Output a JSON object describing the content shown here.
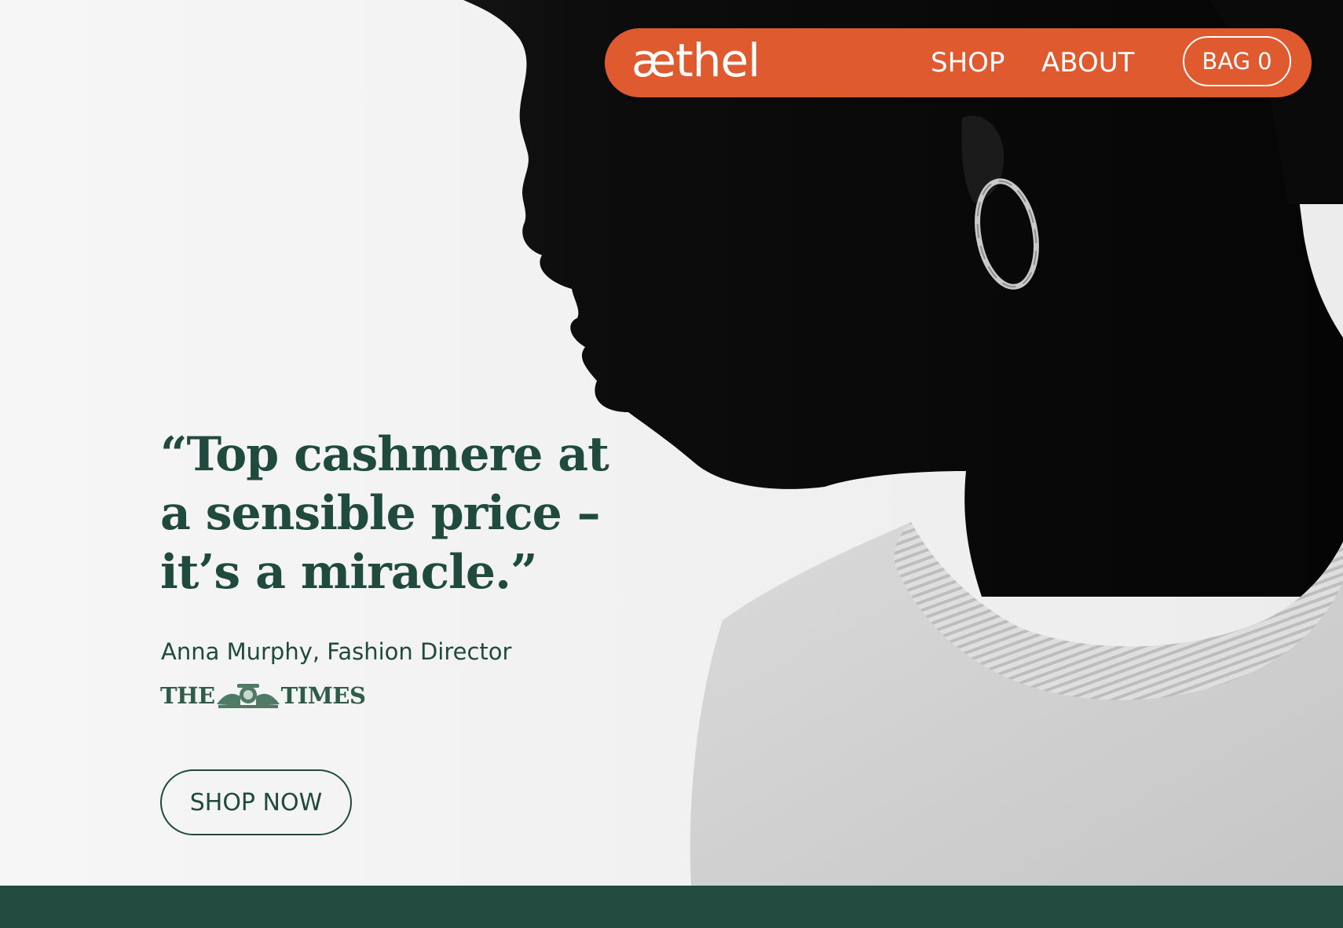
{
  "header": {
    "logo": "æthel",
    "nav": [
      {
        "label": "SHOP"
      },
      {
        "label": "ABOUT"
      }
    ],
    "bag": {
      "label": "BAG",
      "count": "0"
    }
  },
  "hero": {
    "quote": "“Top cashmere at a sensible price – it’s a miracle.”",
    "attribution": "Anna Murphy, Fashion Director",
    "publication_logo": {
      "left": "THE",
      "right": "TIMES"
    },
    "cta_label": "SHOP NOW",
    "image": "profile portrait of a woman with hoop earring wearing a white knit sweater"
  },
  "colors": {
    "nav_background": "#df5a2e",
    "brand_green": "#1f4a3d",
    "footer_band": "#234b40",
    "white": "#ffffff"
  }
}
